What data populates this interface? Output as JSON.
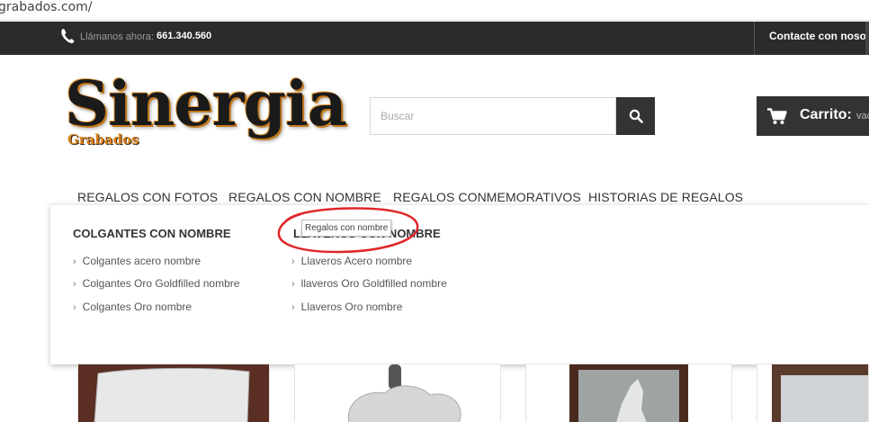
{
  "browser": {
    "url": "grabados.com/"
  },
  "topbar": {
    "call_label": "Llámanos ahora:",
    "phone": "661.340.560",
    "contact": "Contacte con nosotros"
  },
  "logo": {
    "name": "Sinergia",
    "tagline": "Grabados"
  },
  "search": {
    "placeholder": "Buscar"
  },
  "cart": {
    "label": "Carrito:",
    "status": "vacío"
  },
  "nav": {
    "items": [
      {
        "label": "REGALOS CON FOTOS"
      },
      {
        "label": "REGALOS CON NOMBRE"
      },
      {
        "label": "REGALOS CONMEMORATIVOS"
      },
      {
        "label": "HISTORIAS DE REGALOS"
      }
    ]
  },
  "dropdown": {
    "columns": [
      {
        "title": "COLGANTES CON NOMBRE",
        "items": [
          "Colgantes acero nombre",
          "Colgantes Oro Goldfilled nombre",
          "Colgantes Oro nombre"
        ]
      },
      {
        "title": "LLAVEROS CON NOMBRE",
        "items": [
          "Llaveros Acero nombre",
          "llaveros Oro Goldfilled nombre",
          "Llaveros Oro nombre"
        ]
      }
    ]
  },
  "tooltip": {
    "text": "Regalos con nombre"
  },
  "colors": {
    "topbar_bg": "#2b2b2b",
    "button_bg": "#333333",
    "logo_accent": "#d8811e",
    "annotation": "#e0262a"
  },
  "icons": [
    "phone-icon",
    "search-icon",
    "cart-icon",
    "chevron-right-icon"
  ]
}
